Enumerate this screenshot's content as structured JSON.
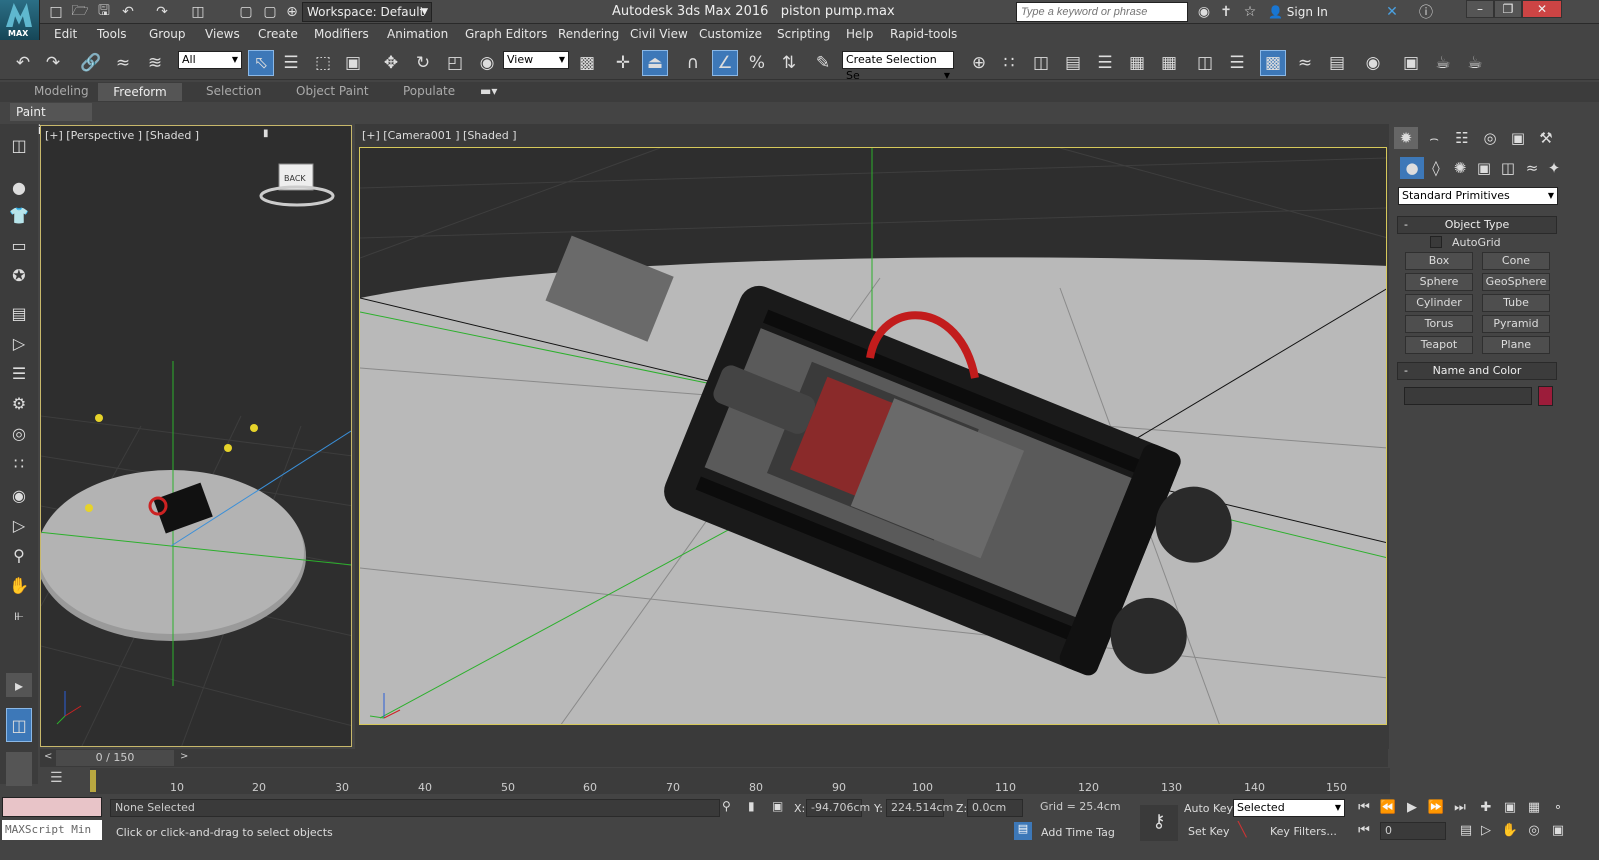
{
  "app": {
    "title": "Autodesk 3ds Max 2016",
    "file": "piston pump.max",
    "logo_text": "MAX"
  },
  "workspace": "Workspace: Default",
  "search": {
    "placeholder": "Type a keyword or phrase"
  },
  "signin": "Sign In",
  "menus": [
    "Edit",
    "Tools",
    "Group",
    "Views",
    "Create",
    "Modifiers",
    "Animation",
    "Graph Editors",
    "Rendering",
    "Civil View",
    "Customize",
    "Scripting",
    "Help",
    "Rapid-tools"
  ],
  "toolbar": {
    "filter": "All",
    "ref_coord": "View",
    "selection_set": "Create Selection Se"
  },
  "ribbon": {
    "tabs": [
      "Modeling",
      "Freeform",
      "Selection",
      "Object Paint",
      "Populate"
    ],
    "active": "Freeform",
    "panel": "Paint Options"
  },
  "viewports": {
    "left_label": "[+] [Perspective ] [Shaded ]",
    "main_label": "[+] [Camera001 ] [Shaded ]",
    "viewcube_face": "BACK"
  },
  "command_panel": {
    "dropdown": "Standard Primitives",
    "rollout_object_type": "Object Type",
    "autogrid": "AutoGrid",
    "buttons": [
      "Box",
      "Cone",
      "Sphere",
      "GeoSphere",
      "Cylinder",
      "Tube",
      "Torus",
      "Pyramid",
      "Teapot",
      "Plane"
    ],
    "rollout_name_color": "Name and Color",
    "swatch_color": "#9c1c3a"
  },
  "timeline": {
    "frame": "0 / 150",
    "ticks": [
      "10",
      "20",
      "30",
      "40",
      "50",
      "60",
      "70",
      "80",
      "90",
      "100",
      "110",
      "120",
      "130",
      "140",
      "150"
    ]
  },
  "status": {
    "maxscript": "MAXScript Min",
    "selection": "None Selected",
    "prompt": "Click or click-and-drag to select objects",
    "x_label": "X:",
    "x": "-94.706cm",
    "y_label": "Y:",
    "y": "224.514cm",
    "z_label": "Z:",
    "z": "0.0cm",
    "grid": "Grid = 25.4cm",
    "add_time_tag": "Add Time Tag",
    "auto_key": "Auto Key",
    "set_key": "Set Key",
    "key_mode": "Selected",
    "key_filters": "Key Filters...",
    "frame_field": "0"
  }
}
